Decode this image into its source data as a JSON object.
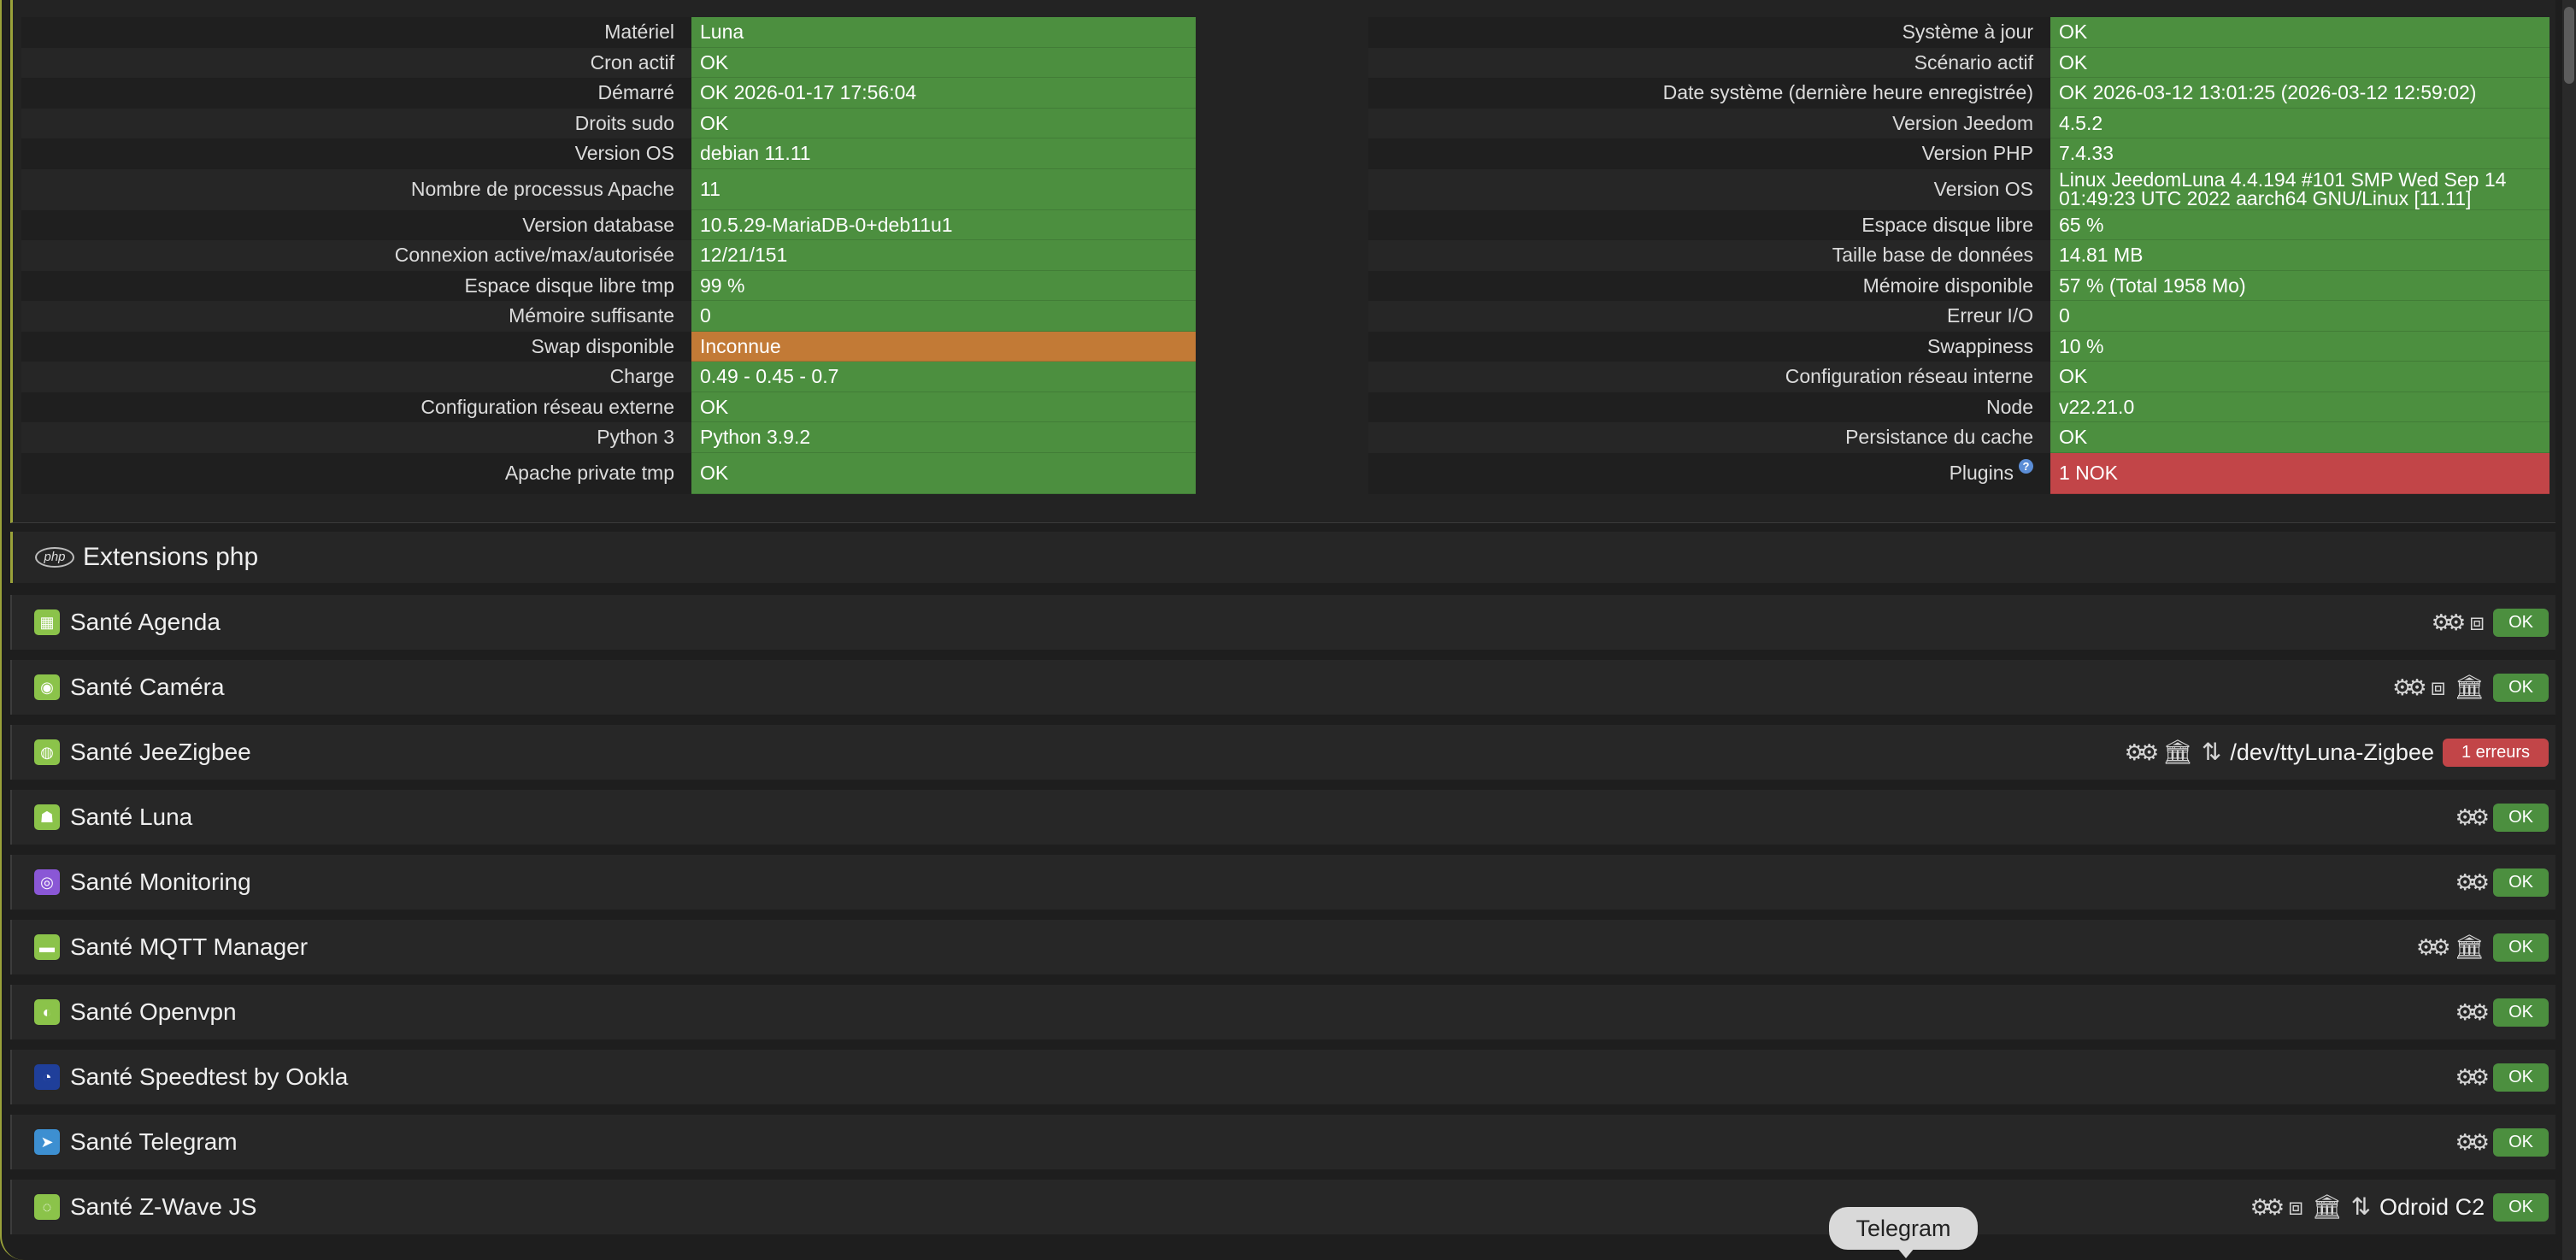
{
  "status_left": [
    {
      "label": "Matériel",
      "value": "Luna",
      "state": "ok"
    },
    {
      "label": "Cron actif",
      "value": "OK",
      "state": "ok"
    },
    {
      "label": "Démarré",
      "value": "OK 2026-01-17 17:56:04",
      "state": "ok"
    },
    {
      "label": "Droits sudo",
      "value": "OK",
      "state": "ok"
    },
    {
      "label": "Version OS",
      "value": "debian 11.11",
      "state": "ok"
    },
    {
      "label": "Nombre de processus Apache",
      "value": "11",
      "state": "ok"
    },
    {
      "label": "Version database",
      "value": "10.5.29-MariaDB-0+deb11u1",
      "state": "ok"
    },
    {
      "label": "Connexion active/max/autorisée",
      "value": "12/21/151",
      "state": "ok"
    },
    {
      "label": "Espace disque libre tmp",
      "value": "99 %",
      "state": "ok"
    },
    {
      "label": "Mémoire suffisante",
      "value": "0",
      "state": "ok"
    },
    {
      "label": "Swap disponible",
      "value": "Inconnue",
      "state": "warn"
    },
    {
      "label": "Charge",
      "value": "0.49 - 0.45 - 0.7",
      "state": "ok"
    },
    {
      "label": "Configuration réseau externe",
      "value": "OK",
      "state": "ok"
    },
    {
      "label": "Python 3",
      "value": "Python 3.9.2",
      "state": "ok"
    },
    {
      "label": "Apache private tmp",
      "value": "OK",
      "state": "ok"
    }
  ],
  "status_right": [
    {
      "label": "Système à jour",
      "value": "OK",
      "state": "ok"
    },
    {
      "label": "Scénario actif",
      "value": "OK",
      "state": "ok"
    },
    {
      "label": "Date système (dernière heure enregistrée)",
      "value": "OK 2026-03-12 13:01:25 (2026-03-12 12:59:02)",
      "state": "ok"
    },
    {
      "label": "Version Jeedom",
      "value": "4.5.2",
      "state": "ok"
    },
    {
      "label": "Version PHP",
      "value": "7.4.33",
      "state": "ok"
    },
    {
      "label": "Version OS",
      "value": "Linux JeedomLuna 4.4.194 #101 SMP Wed Sep 14 01:49:23 UTC 2022 aarch64 GNU/Linux [11.11]",
      "state": "ok"
    },
    {
      "label": "Espace disque libre",
      "value": "65 %",
      "state": "ok"
    },
    {
      "label": "Taille base de données",
      "value": "14.81 MB",
      "state": "ok"
    },
    {
      "label": "Mémoire disponible",
      "value": "57 % (Total 1958 Mo)",
      "state": "ok"
    },
    {
      "label": "Erreur I/O",
      "value": "0",
      "state": "ok"
    },
    {
      "label": "Swappiness",
      "value": "10 %",
      "state": "ok"
    },
    {
      "label": "Configuration réseau interne",
      "value": "OK",
      "state": "ok"
    },
    {
      "label": "Node",
      "value": "v22.21.0",
      "state": "ok"
    },
    {
      "label": "Persistance du cache",
      "value": "OK",
      "state": "ok"
    },
    {
      "label": "Plugins",
      "value": "1 NOK",
      "state": "nok"
    }
  ],
  "php_section": {
    "logo_text": "php",
    "title": "Extensions php"
  },
  "health": [
    {
      "name": "Santé Agenda",
      "status": "OK",
      "path": ""
    },
    {
      "name": "Santé Caméra",
      "status": "OK",
      "path": ""
    },
    {
      "name": "Santé JeeZigbee",
      "status": "1 erreurs",
      "path": "/dev/ttyLuna-Zigbee"
    },
    {
      "name": "Santé Luna",
      "status": "OK",
      "path": ""
    },
    {
      "name": "Santé Monitoring",
      "status": "OK",
      "path": ""
    },
    {
      "name": "Santé MQTT Manager",
      "status": "OK",
      "path": ""
    },
    {
      "name": "Santé Openvpn",
      "status": "OK",
      "path": ""
    },
    {
      "name": "Santé Speedtest by Ookla",
      "status": "OK",
      "path": ""
    },
    {
      "name": "Santé Telegram",
      "status": "OK",
      "path": ""
    },
    {
      "name": "Santé Z-Wave JS",
      "status": "OK",
      "path": "Odroid C2"
    }
  ],
  "tooltip": {
    "text": "Telegram"
  },
  "colors": {
    "ok": "#4c8f3f",
    "warn": "#c27a36",
    "nok": "#c24548",
    "accent": "#9aa23a"
  }
}
